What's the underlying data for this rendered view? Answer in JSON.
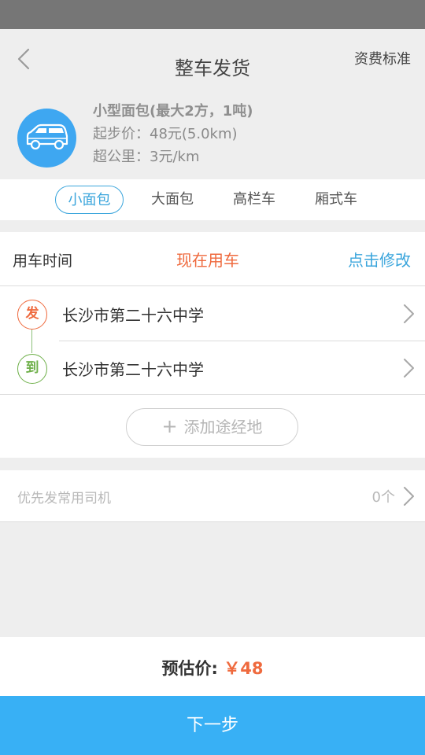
{
  "header": {
    "title": "整车发货",
    "rate_link": "资费标准"
  },
  "vehicle": {
    "name": "小型面包(最大2方，1吨)",
    "base_price": "起步价：48元(5.0km)",
    "extra_km": "超公里：3元/km"
  },
  "tabs": [
    {
      "label": "小面包",
      "active": true
    },
    {
      "label": "大面包",
      "active": false
    },
    {
      "label": "高栏车",
      "active": false
    },
    {
      "label": "厢式车",
      "active": false
    }
  ],
  "time_row": {
    "label": "用车时间",
    "value": "现在用车",
    "action": "点击修改"
  },
  "route": {
    "from_badge": "发",
    "from": "长沙市第二十六中学",
    "to_badge": "到",
    "to": "长沙市第二十六中学",
    "add_stop": "添加途经地",
    "add_stop_icon": "+"
  },
  "driver": {
    "label": "优先发常用司机",
    "count": "0个"
  },
  "estimate": {
    "label": "预估价:",
    "amount": "￥48"
  },
  "next_button": "下一步",
  "colors": {
    "accent": "#3aa5dc",
    "button": "#38b0f5",
    "highlight": "#ef6a3e",
    "from_badge": "#ef6a3e",
    "to_badge": "#6fb04a"
  },
  "icons": {
    "back": "chevron-left-icon",
    "vehicle": "van-icon",
    "row_arrow": "chevron-right-icon"
  }
}
